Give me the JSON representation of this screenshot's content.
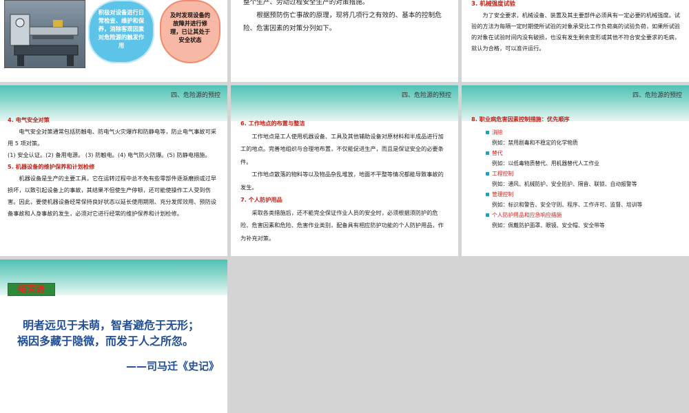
{
  "slide1": {
    "bubble_blue": "积极对设备进行日常检查、维护和保养，消除客观因素对危险源的触发作用",
    "bubble_orange": "及时发现设备的故障并进行修理，已让其处于安全状态"
  },
  "slide2": {
    "line1": "整个生产、劳动过程安全生产的对策措施。",
    "line2": "根据预防伤亡事故的原理，现将几项行之有效的、基本的控制危险、危害因素的对策分列如下。"
  },
  "slide3": {
    "heading": "3. 机械强度试验",
    "para": "为了安全要求，机械设备、装置及其主要部件必须具有一定必要的机械强度。试验的方法为每隔一定时期使所试验的对象承受比工作负荷高的试验负荷，如果所试验的对象在试验时间内没有破损，也没有发生剩余变形或其他不符合安全要求的毛病，就认为合格，可以准许运行。"
  },
  "section_title": "四、危险源的预控",
  "slide4": {
    "h4": "4. 电气安全对策",
    "p4": "电气安全对策通常包括防触电、防电气火灾爆炸和防静电等，防止电气事故可采用 5 项对策。",
    "list4": "(1) 安全认证。(2) 备用电源。 (3) 防触电。(4) 电气防火防爆。(5) 防静电措施。",
    "h5": "5. 机器设备的维护保养和计划检修",
    "p5": "机器设备是生产的主要工具，它在运转过程中总不免有些零部件逐渐磨损或过早损坏，以致引起设备上的事故，其结果不但使生产停顿，还可能使操作工人受到伤害。因此，要使机器设备经常保持良好状态以延长使用期限、充分发挥效用、预防设备事故和人身事故的发生，必须对它进行经常的维护保养和计划检修。"
  },
  "slide5": {
    "h6": "6. 工作地点的布置与整洁",
    "p6a": "工作地点是工人使用机器设备、工具及其他辅助设备对原材料和半成品进行加工的地点。完善地组织与合理地布置，不仅能促进生产，而且是保证安全的必要条件。",
    "p6b": "工作地点散落的物料等以及物品杂乱堆放，地面不平整等情况都能导致事故的发生。",
    "h7": "7. 个人防护用品",
    "p7": "采取各类措施后，还不能完全保证作业人员的安全时，必须根据须防护的危险、危害因素和危险、危害作业类别，配备具有相应防护功能的个人防护用品，作为补充对策。"
  },
  "slide6": {
    "h8": "8. 职业病危害因素控制措施：优先顺序",
    "items": [
      {
        "label": "消除",
        "example": "例如：禁用剧毒和不稳定的化学物质"
      },
      {
        "label": "替代",
        "example": "例如：以低毒物质替代、用机器替代人工作业"
      },
      {
        "label": "工程控制",
        "example": "例如：通风、机械防护、安全防护、隔音、联锁、自动报警等"
      },
      {
        "label": "管理控制",
        "example": "例如：标识和警告、安全守则、程序、工作许可、监督、培训等"
      },
      {
        "label": "个人防护用品和应急响应措施",
        "example": "例如：佩戴防护面罩、眼镜、安全帽、安全带等"
      }
    ]
  },
  "slide7": {
    "badge": "结束语",
    "quote1": "明者远见于未萌，智者避危于无形；",
    "quote2": "祸因多藏于隐微，而发于人之所忽。",
    "attribution": "——司马迁《史记》"
  }
}
